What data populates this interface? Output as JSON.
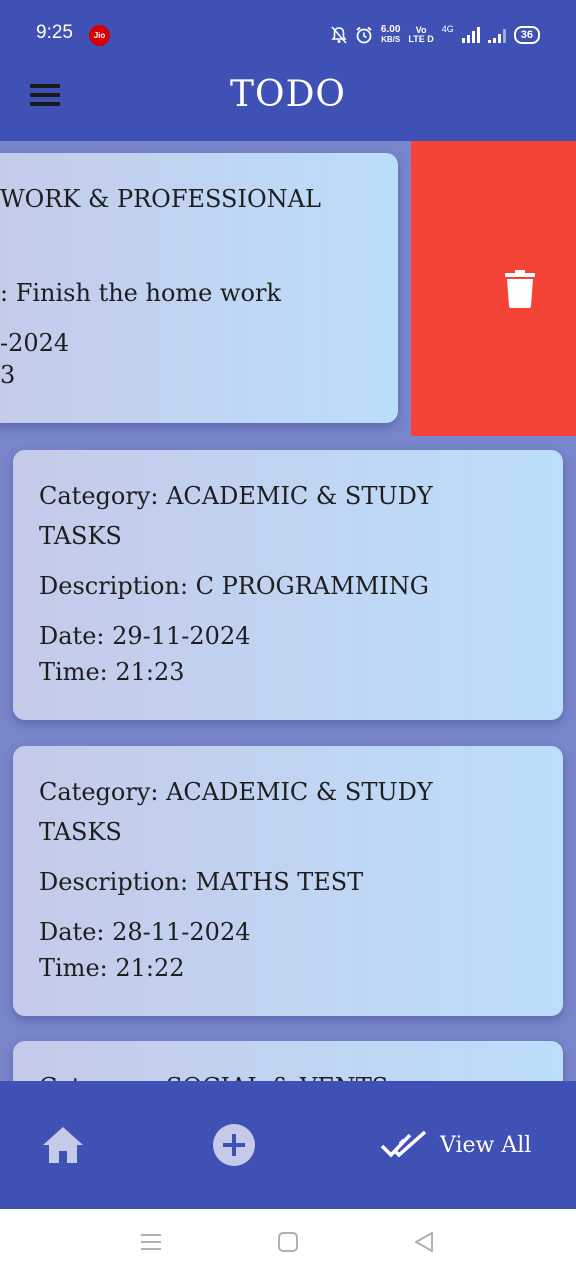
{
  "status_bar": {
    "time": "9:25",
    "carrier_badge": "Jio",
    "speed_value": "6.00",
    "speed_unit": "KB/S",
    "volte_top": "Vo",
    "volte_bottom": "LTE D",
    "network": "4G",
    "battery": "36"
  },
  "app_bar": {
    "title": "TODO",
    "menu_icon": "hamburger-menu-icon"
  },
  "todos": [
    {
      "category": "WORK & PROFESSIONAL",
      "description": ": Finish the home work",
      "date": "-2024",
      "time": "3",
      "swiped": true
    },
    {
      "category_line1": "Category: ACADEMIC & STUDY",
      "category_line2": "TASKS",
      "description": "Description: C PROGRAMMING",
      "date": "Date: 29-11-2024",
      "time": "Time: 21:23"
    },
    {
      "category_line1": "Category: ACADEMIC & STUDY",
      "category_line2": "TASKS",
      "description": "Description: MATHS TEST",
      "date": "Date: 28-11-2024",
      "time": "Time: 21:22"
    },
    {
      "category": "Category: SOCIAL & VENTS"
    }
  ],
  "swipe_action": {
    "icon": "delete-icon",
    "color": "#f44336"
  },
  "bottom_nav": {
    "home_icon": "home-icon",
    "add_icon": "add-circle-icon",
    "view_all_label": "View All",
    "view_all_icon": "double-check-icon"
  },
  "colors": {
    "primary": "#3f51b5",
    "background": "#7986cb",
    "delete": "#f44336"
  }
}
